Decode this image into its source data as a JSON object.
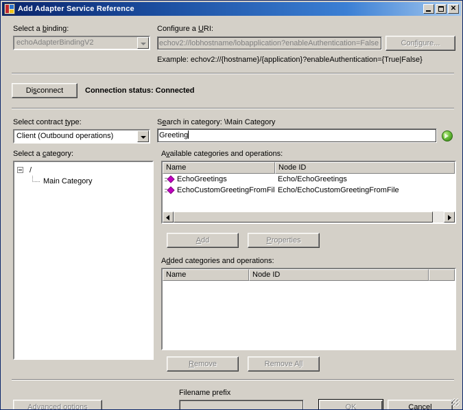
{
  "window": {
    "title": "Add Adapter Service Reference",
    "icon": "adapter-window-icon",
    "minimize_label": "",
    "maximize_label": "",
    "close_label": "✕"
  },
  "binding": {
    "label_pre": "Select a ",
    "label_accel": "b",
    "label_post": "inding:",
    "value": "echoAdapterBindingV2",
    "enabled": false
  },
  "uri": {
    "label_pre": "Configure a ",
    "label_accel": "U",
    "label_post": "RI:",
    "value": "echov2://lobhostname/lobapplication?enableAuthentication=False",
    "example": "Example: echov2://{hostname}/{application}?enableAuthentication={True|False}",
    "configure_button": {
      "pre": "Con",
      "accel": "f",
      "post": "igure...",
      "enabled": false
    }
  },
  "connection": {
    "disconnect_button": {
      "pre": "Di",
      "accel": "s",
      "post": "connect",
      "enabled": true
    },
    "status_label": "Connection status: Connected"
  },
  "contract": {
    "label_pre": "Select contract ",
    "label_accel": "t",
    "label_post": "ype:",
    "value": "Client (Outbound operations)",
    "enabled": true
  },
  "category_tree": {
    "label_pre": "Select a ",
    "label_accel": "c",
    "label_post": "ategory:",
    "root": "/",
    "children": [
      "Main Category"
    ]
  },
  "search": {
    "label_pre": "S",
    "label_accel": "e",
    "label_post": "arch in category: \\Main Category",
    "value": "Greeting",
    "placeholder": "",
    "go_icon": "green-go-arrow-icon"
  },
  "available": {
    "label_pre": "A",
    "label_accel": "v",
    "label_post": "ailable categories and operations:",
    "columns": [
      "Name",
      "Node ID"
    ],
    "rows": [
      {
        "name": "EchoGreetings",
        "node_id": "Echo/EchoGreetings",
        "icon": "method-diamond-icon"
      },
      {
        "name": "EchoCustomGreetingFromFile",
        "node_id": "Echo/EchoCustomGreetingFromFile",
        "icon": "method-diamond-icon"
      }
    ],
    "add_button": {
      "pre": "",
      "accel": "A",
      "post": "dd",
      "enabled": false
    },
    "properties_button": {
      "pre": "",
      "accel": "P",
      "post": "roperties",
      "enabled": false
    }
  },
  "added": {
    "label_pre": "A",
    "label_accel": "d",
    "label_post": "ded categories and operations:",
    "columns": [
      "Name",
      "Node ID",
      ""
    ],
    "rows": [],
    "remove_button": {
      "pre": "",
      "accel": "R",
      "post": "emove",
      "enabled": false
    },
    "remove_all_button": {
      "pre": "Remove A",
      "accel": "l",
      "post": "l",
      "enabled": false
    }
  },
  "footer": {
    "advanced_button": {
      "pre": "Advanced ",
      "accel": "o",
      "post": "ptions",
      "enabled": false
    },
    "filename_prefix_label": "Filename prefix",
    "filename_prefix_value": "",
    "ok_button": {
      "label": "OK",
      "enabled": false,
      "default": true
    },
    "cancel_button": {
      "label": "Cancel",
      "enabled": true
    }
  },
  "colors": {
    "dialog_face": "#d4d0c8",
    "title_active_start": "#0a246a",
    "title_active_end": "#a6caf0",
    "disabled_text": "#808080",
    "method_icon": "#c000c0",
    "go_button_green": "#6bbf3b"
  }
}
